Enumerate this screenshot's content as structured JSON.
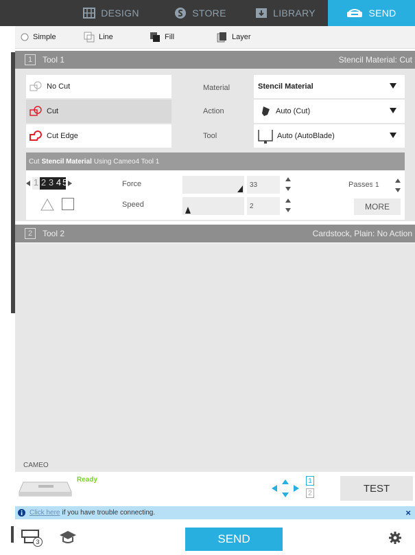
{
  "nav": {
    "tabs": [
      {
        "label": "DESIGN",
        "icon": "design-grid-icon"
      },
      {
        "label": "STORE",
        "icon": "store-s-icon"
      },
      {
        "label": "LIBRARY",
        "icon": "library-icon"
      },
      {
        "label": "SEND",
        "icon": "send-machine-icon"
      }
    ],
    "active": "SEND"
  },
  "modes": [
    {
      "label": "Simple",
      "icon": "radio-icon"
    },
    {
      "label": "Line",
      "icon": "line-icon"
    },
    {
      "label": "Fill",
      "icon": "fill-icon"
    },
    {
      "label": "Layer",
      "icon": "layer-icon"
    }
  ],
  "tool1": {
    "number": "1",
    "name": "Tool 1",
    "summary": "Stencil Material: Cut",
    "cut_options": [
      "No Cut",
      "Cut",
      "Cut Edge"
    ],
    "selected_cut": "Cut",
    "material_label": "Material",
    "material_value": "Stencil Material",
    "action_label": "Action",
    "action_value": "Auto (Cut)",
    "tool_label": "Tool",
    "tool_value": "Auto (AutoBlade)",
    "cut_using": {
      "prefix": "Cut",
      "material": "Stencil Material",
      "suffix": "Using Cameo4 Tool 1"
    },
    "blade_digits": [
      "1",
      "2",
      "3",
      "4",
      "5"
    ],
    "force_label": "Force",
    "force_value": "33",
    "force_fraction": 0.33,
    "speed_label": "Speed",
    "speed_value": "2",
    "speed_fraction": 0.1,
    "passes_label": "Passes",
    "passes_value": "1",
    "more_label": "MORE"
  },
  "tool2": {
    "number": "2",
    "name": "Tool 2",
    "summary": "Cardstock, Plain: No Action"
  },
  "device": {
    "section_label": "CAMEO",
    "status": "Ready",
    "status_color": "#7bd321",
    "tool_slots": [
      "1",
      "2"
    ],
    "test_label": "TEST"
  },
  "info": {
    "link": "Click here",
    "text": "if you have trouble connecting.",
    "close": "×"
  },
  "footer": {
    "send_label": "SEND",
    "badge_count": "3"
  },
  "colors": {
    "accent": "#29aee0",
    "nav_bg": "#3a3a3a",
    "cut_red": "#e0202a"
  }
}
